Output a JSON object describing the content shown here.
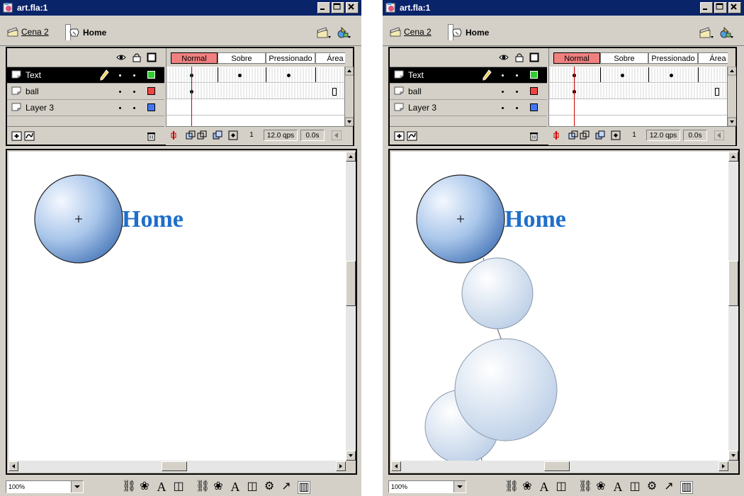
{
  "windows": [
    {
      "id": "left",
      "title": "art.fla:1",
      "scenes": {
        "parent": "Cena 2",
        "current": "Home"
      },
      "layers": [
        {
          "name": "Text",
          "color": "#33cc33",
          "selected": true
        },
        {
          "name": "ball",
          "color": "#ee4444",
          "selected": false
        },
        {
          "name": "Layer 3",
          "color": "#4477ee",
          "selected": false
        }
      ],
      "frame_labels": [
        "Normal",
        "Sobre",
        "Pressionado",
        "Área"
      ],
      "status": {
        "frame": "1",
        "fps": "12.0 qps",
        "time": "0.0s"
      },
      "stage_text": "Home",
      "zoom": "100%"
    },
    {
      "id": "right",
      "title": "art.fla:1",
      "scenes": {
        "parent": "Cena 2",
        "current": "Home"
      },
      "layers": [
        {
          "name": "Text",
          "color": "#33cc33",
          "selected": true
        },
        {
          "name": "ball",
          "color": "#ee4444",
          "selected": false
        },
        {
          "name": "Layer 3",
          "color": "#4477ee",
          "selected": false
        }
      ],
      "frame_labels": [
        "Normal",
        "Sobre",
        "Pressionado",
        "Área"
      ],
      "status": {
        "frame": "1",
        "fps": "12.0 qps",
        "time": "0.0s"
      },
      "stage_text": "Home",
      "zoom": "100%"
    }
  ],
  "colors": {
    "titlebar": "#0a246a",
    "active_frame": "#f08080",
    "home_text": "#1e6fc9",
    "playhead": "#d00000"
  }
}
